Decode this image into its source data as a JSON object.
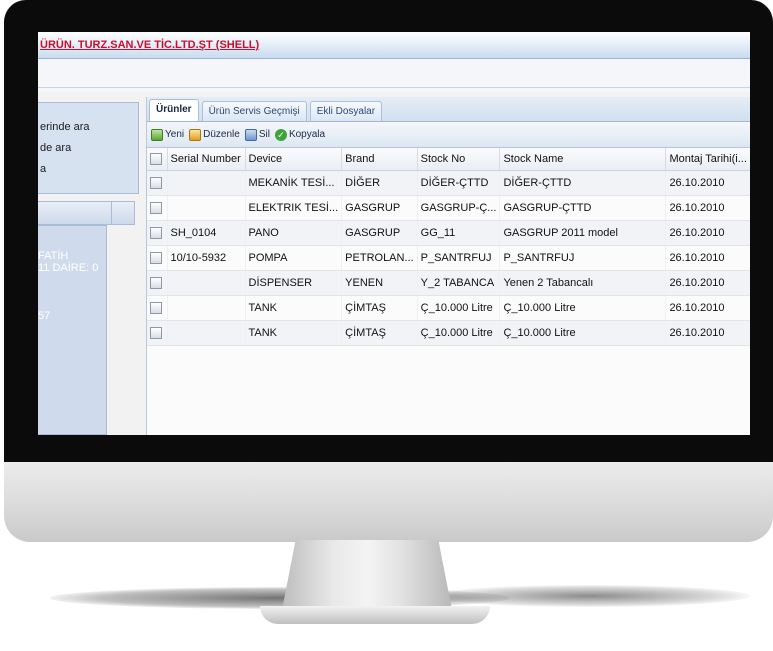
{
  "company_title": "ÜRÜN. TURZ.SAN.VE TİC.LTD.ŞT (SHELL)",
  "search_options": [
    "erinde ara",
    "de ara",
    "a"
  ],
  "detail_text": {
    "line1": "FATİH",
    "line2": "11 DAİRE: 0",
    "line3": "57"
  },
  "tabs": [
    "Ürünler",
    "Ürün Servis Geçmişi",
    "Ekli Dosyalar"
  ],
  "toolbar": {
    "new": "Yeni",
    "edit": "Düzenle",
    "delete": "Sil",
    "copy": "Kopyala"
  },
  "columns": [
    "Serial Number",
    "Device",
    "Brand",
    "Stock No",
    "Stock Name",
    "Montaj Tarihi(i..."
  ],
  "rows": [
    {
      "serial": "",
      "device": "MEKANİK TESİ...",
      "brand": "DİĞER",
      "stock_no": "DİĞER-ÇTTD",
      "stock_name": "DİĞER-ÇTTD",
      "date": "26.10.2010"
    },
    {
      "serial": "",
      "device": "ELEKTRIK TESİ...",
      "brand": "GASGRUP",
      "stock_no": "GASGRUP-Ç...",
      "stock_name": "GASGRUP-ÇTTD",
      "date": "26.10.2010"
    },
    {
      "serial": "SH_0104",
      "device": "PANO",
      "brand": "GASGRUP",
      "stock_no": "GG_11",
      "stock_name": "GASGRUP 2011 model",
      "date": "26.10.2010"
    },
    {
      "serial": "10/10-5932",
      "device": "POMPA",
      "brand": "PETROLAN...",
      "stock_no": "P_SANTRFUJ",
      "stock_name": "P_SANTRFUJ",
      "date": "26.10.2010"
    },
    {
      "serial": "",
      "device": "DİSPENSER",
      "brand": "YENEN",
      "stock_no": "Y_2 TABANCA",
      "stock_name": "Yenen 2 Tabancalı",
      "date": "26.10.2010"
    },
    {
      "serial": "",
      "device": "TANK",
      "brand": "ÇİMTAŞ",
      "stock_no": "Ç_10.000 Litre",
      "stock_name": "Ç_10.000 Litre",
      "date": "26.10.2010"
    },
    {
      "serial": "",
      "device": "TANK",
      "brand": "ÇİMTAŞ",
      "stock_no": "Ç_10.000 Litre",
      "stock_name": "Ç_10.000 Litre",
      "date": "26.10.2010"
    }
  ]
}
